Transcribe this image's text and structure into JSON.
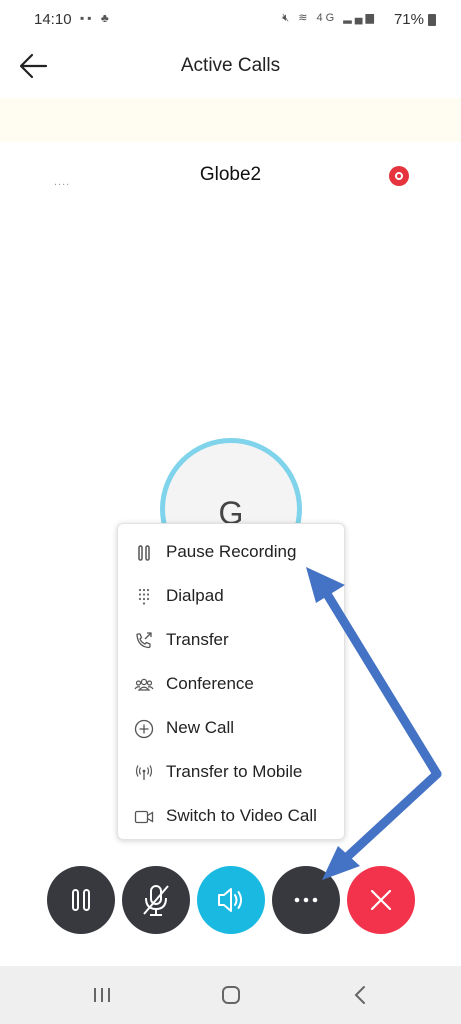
{
  "status": {
    "time": "14:10",
    "battery": "71%",
    "network_label": "4G"
  },
  "header": {
    "title": "Active Calls"
  },
  "call": {
    "dots": "....",
    "name": "Globe2",
    "avatar_letter": "G"
  },
  "menu": {
    "items": [
      {
        "label": "Pause Recording",
        "icon": "pause-icon"
      },
      {
        "label": "Dialpad",
        "icon": "dialpad-icon"
      },
      {
        "label": "Transfer",
        "icon": "transfer-icon"
      },
      {
        "label": "Conference",
        "icon": "conference-icon"
      },
      {
        "label": "New Call",
        "icon": "add-circle-icon"
      },
      {
        "label": "Transfer to Mobile",
        "icon": "broadcast-icon"
      },
      {
        "label": "Switch to Video Call",
        "icon": "video-icon"
      }
    ]
  },
  "controls": [
    "hold",
    "mute",
    "speaker",
    "more",
    "end-call"
  ],
  "colors": {
    "hold": "#37393f",
    "speaker": "#19b9e2",
    "end_call": "#f2334b",
    "avatar_ring": "#7fd3ea",
    "record": "#e5343e",
    "arrow": "#4472c4"
  }
}
